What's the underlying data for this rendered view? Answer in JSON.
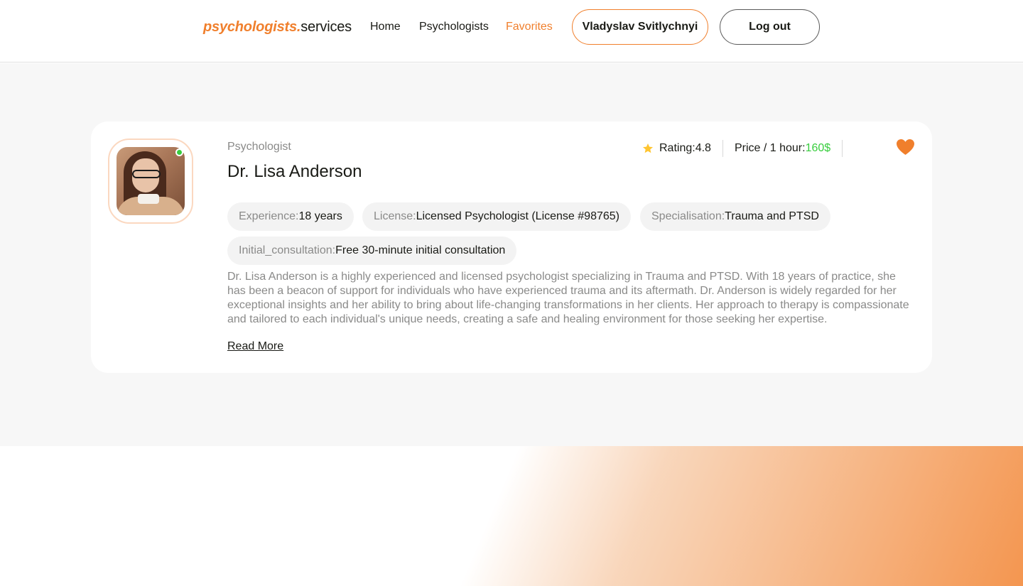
{
  "header": {
    "logo_accent": "psychologists.",
    "logo_rest": "services",
    "nav": [
      {
        "label": "Home"
      },
      {
        "label": "Psychologists"
      },
      {
        "label": "Favorites"
      }
    ],
    "user_name": "Vladyslav Svitlychnyi",
    "logout_label": "Log out"
  },
  "card": {
    "role": "Psychologist",
    "name": "Dr. Lisa Anderson",
    "rating_label": "Rating: ",
    "rating_value": "4.8",
    "price_label": "Price / 1 hour: ",
    "price_value": "160$",
    "tags": [
      {
        "key": "Experience: ",
        "value": "18 years"
      },
      {
        "key": "License: ",
        "value": "Licensed Psychologist (License #98765)"
      },
      {
        "key": "Specialisation: ",
        "value": "Trauma and PTSD"
      },
      {
        "key": "Initial_consultation: ",
        "value": "Free 30-minute initial consultation"
      }
    ],
    "description": "Dr. Lisa Anderson is a highly experienced and licensed psychologist specializing in Trauma and PTSD. With 18 years of practice, she has been a beacon of support for individuals who have experienced trauma and its aftermath. Dr. Anderson is widely regarded for her exceptional insights and her ability to bring about life-changing transformations in her clients. Her approach to therapy is compassionate and tailored to each individual's unique needs, creating a safe and healing environment for those seeking her expertise.",
    "read_more": "Read More",
    "online": true,
    "favorited": true
  },
  "colors": {
    "accent": "#f07f2c",
    "online": "#38cd3e",
    "price": "#38cd3e",
    "star": "#ffc531",
    "muted_text": "#8a8a89",
    "page_bg": "#f7f7f7"
  },
  "icons": [
    "star-icon",
    "heart-icon",
    "online-status-dot"
  ]
}
